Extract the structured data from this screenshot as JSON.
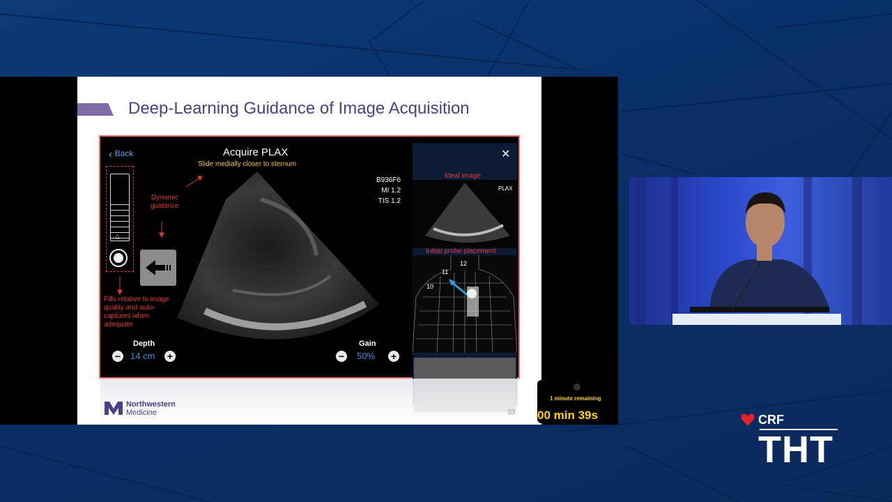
{
  "slide": {
    "title": "Deep-Learning Guidance of Image Acquisition",
    "page_number": "33"
  },
  "ultrasound": {
    "back_label": "Back",
    "view_title": "Acquire PLAX",
    "instruction": "Slide medially closer to sternum",
    "device_info": [
      "B936F6",
      "MI 1.2",
      "TIS 1.2"
    ],
    "annotation_dynamic": "Dynamic\nguidance",
    "annotation_fills": "Fills relative to image\nquality and auto-\ncaptures when\nadequate",
    "depth_label": "Depth",
    "depth_value": "14 cm",
    "gain_label": "Gain",
    "gain_value": "50%"
  },
  "ideal_panel": {
    "ideal_label": "Ideal image",
    "plax_label": "PLAX",
    "probe_label": "Initial probe placement",
    "positions": [
      "10",
      "11",
      "12"
    ]
  },
  "logo": {
    "line1": "Northwestern",
    "line2": "Medicine"
  },
  "timer": {
    "remaining": "1 minute remaining",
    "countdown": "00 min 39s"
  },
  "branding": {
    "crf": "CRF",
    "tht": "THT"
  },
  "colors": {
    "accent_purple": "#4b3f86",
    "annotation_red": "#e43b3b",
    "value_blue": "#3b8fe0",
    "timer_yellow": "#ffd400",
    "crf_red": "#e3202e"
  }
}
